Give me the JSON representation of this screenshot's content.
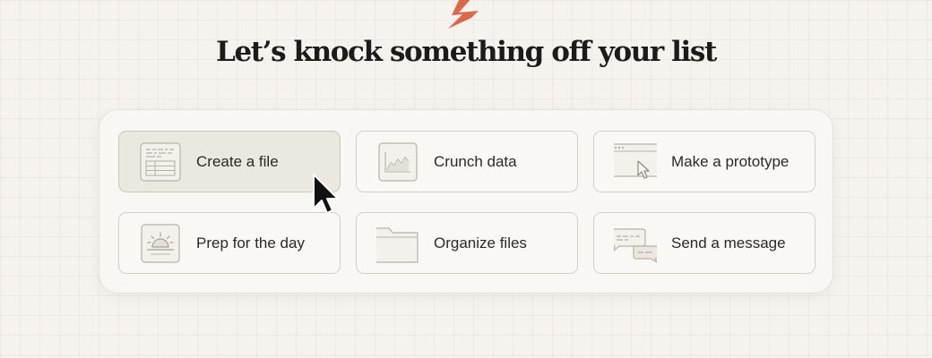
{
  "headline": "Let’s knock something off your list",
  "cards": [
    {
      "label": "Create a file",
      "icon": "spreadsheet-icon",
      "state": "hovered"
    },
    {
      "label": "Crunch data",
      "icon": "line-chart-icon"
    },
    {
      "label": "Make a prototype",
      "icon": "browser-window-cursor-icon"
    },
    {
      "label": "Prep for the day",
      "icon": "sunrise-icon"
    },
    {
      "label": "Organize files",
      "icon": "folder-icon"
    },
    {
      "label": "Send a message",
      "icon": "chat-bubbles-icon"
    }
  ],
  "colors": {
    "accent": "#d9694a",
    "background": "#f6f3ee",
    "card_border": "#d4cfc6",
    "hover_card": "#ebe8e0",
    "text": "#1d1b19"
  }
}
